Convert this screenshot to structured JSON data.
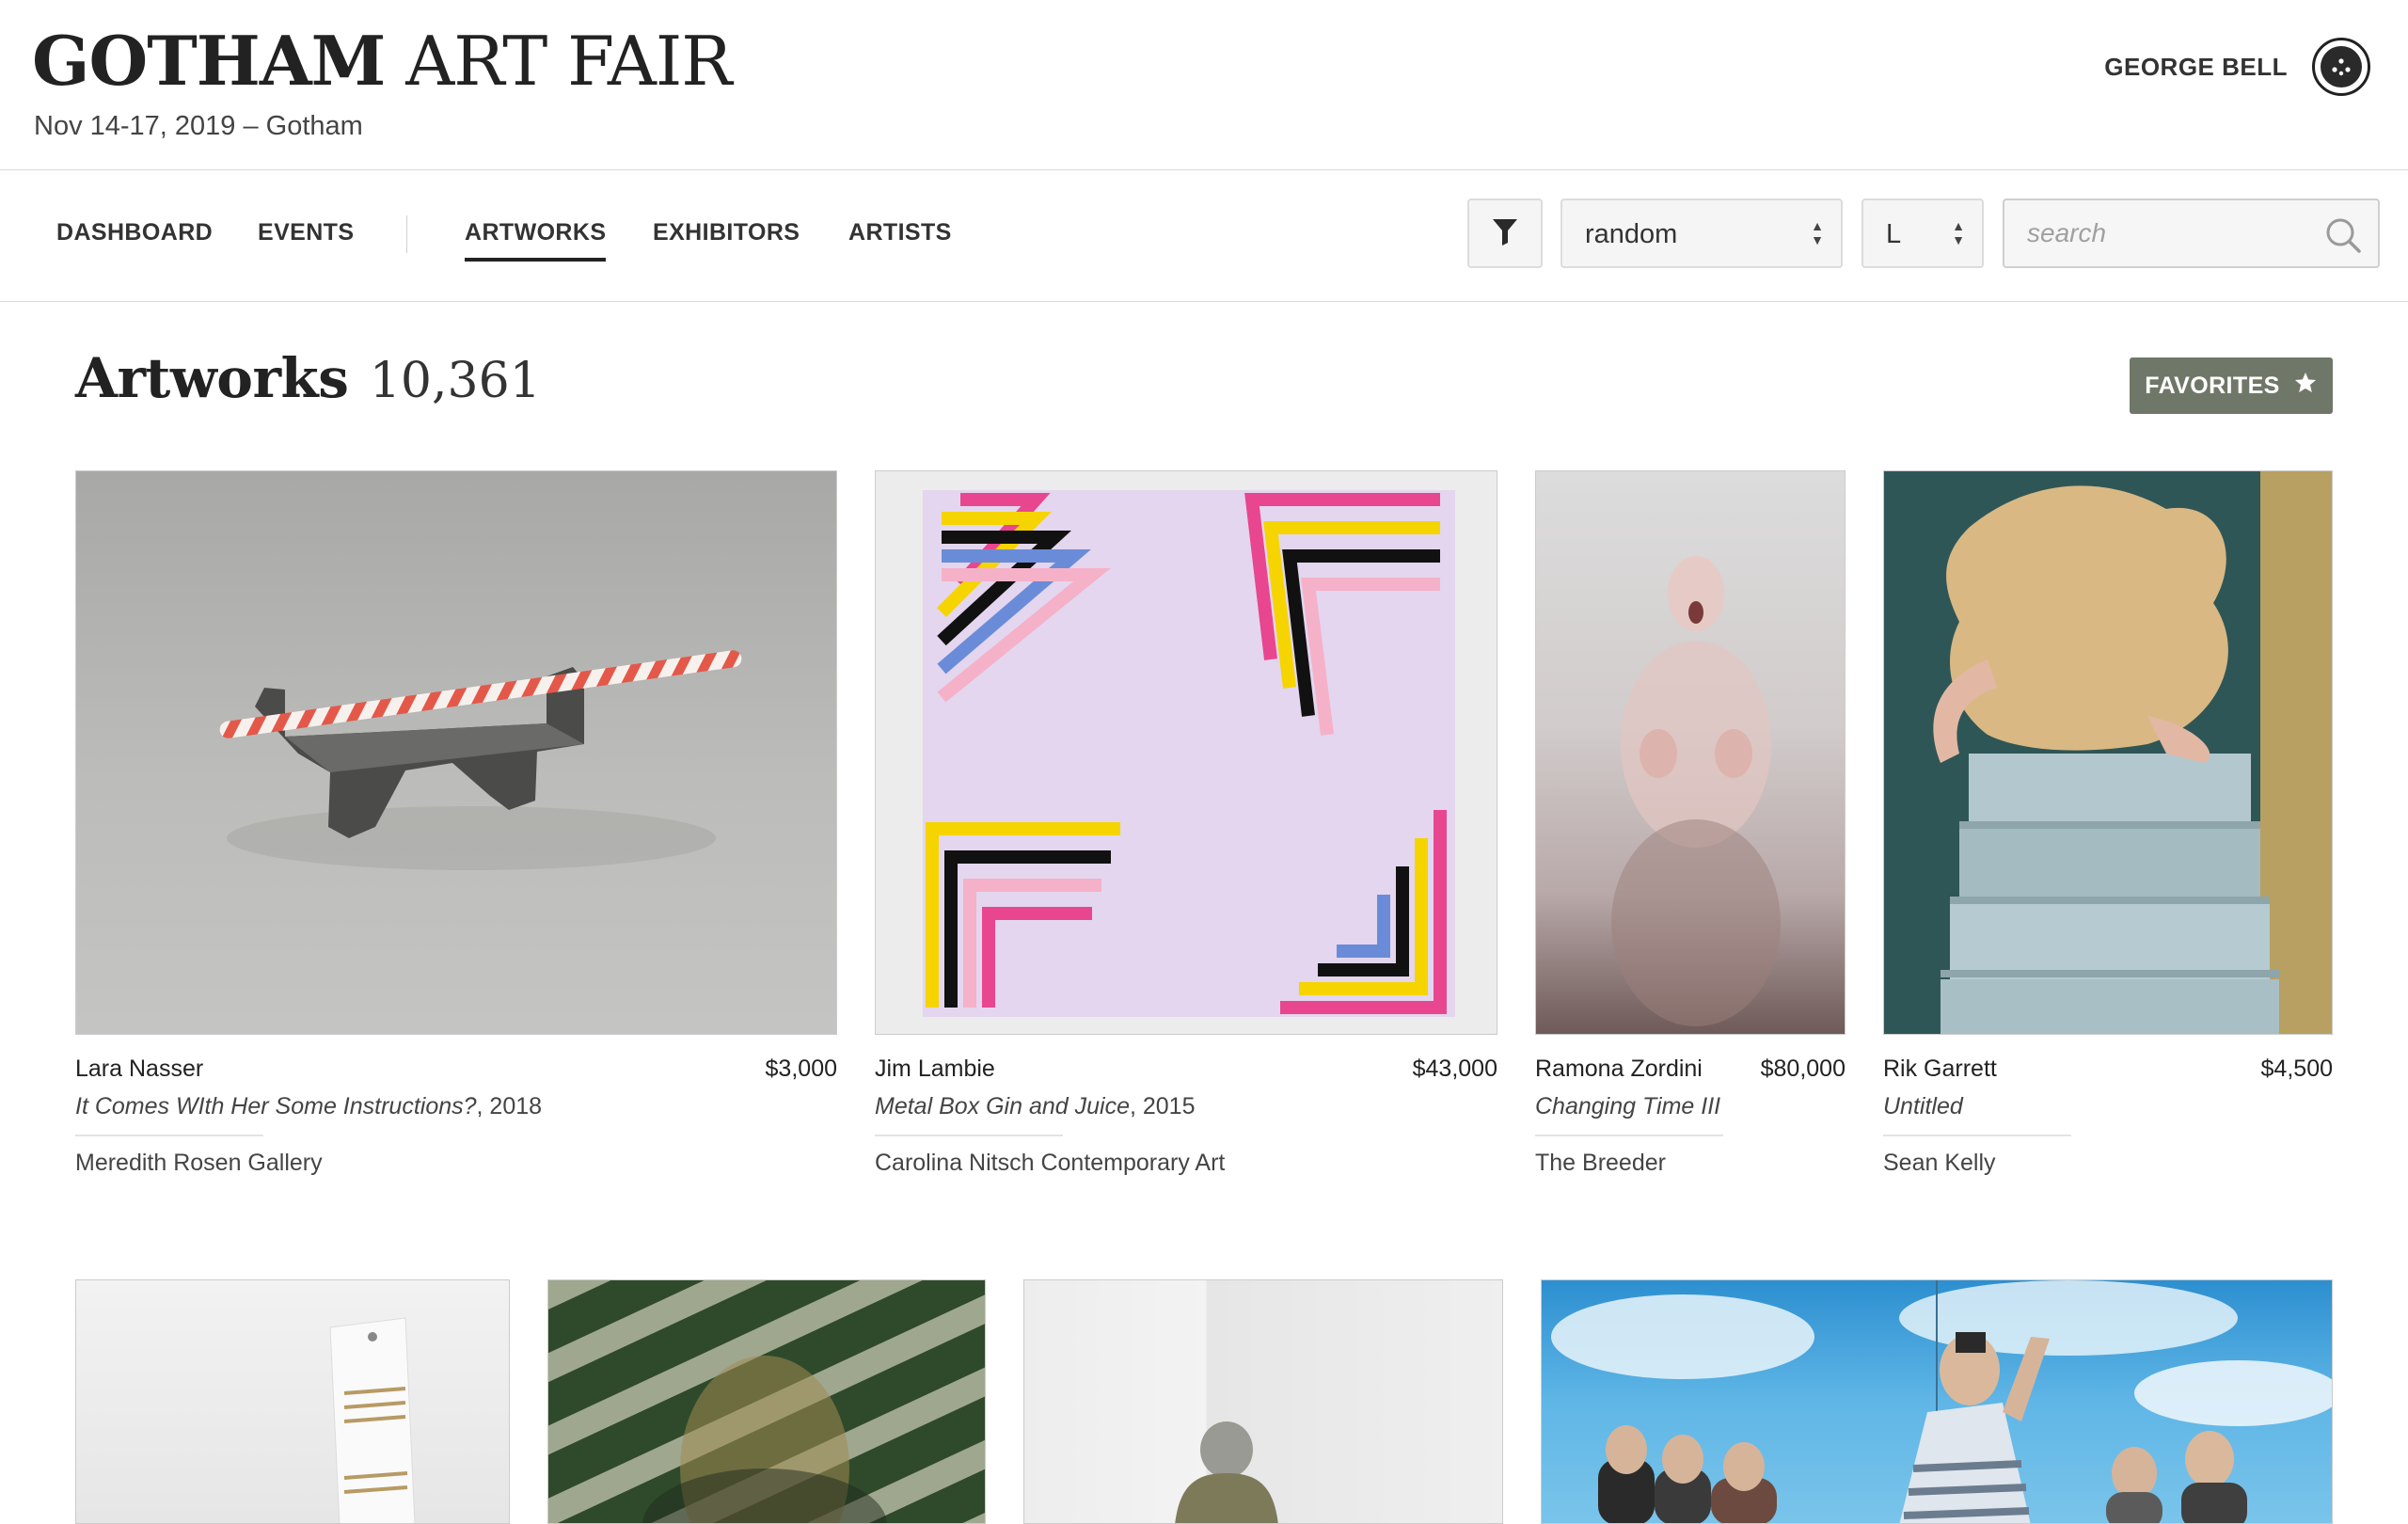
{
  "brand": {
    "strong": "GOTHAM",
    "light": "ART FAIR"
  },
  "dates": "Nov 14-17, 2019 – Gotham",
  "user": {
    "name": "GEORGE BELL"
  },
  "nav": {
    "items": [
      "DASHBOARD",
      "EVENTS",
      "ARTWORKS",
      "EXHIBITORS",
      "ARTISTS"
    ],
    "active": "ARTWORKS"
  },
  "controls": {
    "sort_value": "random",
    "size_value": "L",
    "search_placeholder": "search"
  },
  "page": {
    "title": "Artworks",
    "count": "10,361",
    "favorites_label": "FAVORITES"
  },
  "artworks": [
    {
      "artist": "Lara Nasser",
      "price": "$3,000",
      "title": "It Comes WIth Her Some Instructions?",
      "year": ", 2018",
      "gallery": "Meredith Rosen Gallery"
    },
    {
      "artist": "Jim Lambie",
      "price": "$43,000",
      "title": "Metal Box Gin and Juice",
      "year": ", 2015",
      "gallery": "Carolina Nitsch Contemporary Art"
    },
    {
      "artist": "Ramona Zordini",
      "price": "$80,000",
      "title": "Changing Time III",
      "year": "",
      "gallery": "The Breeder"
    },
    {
      "artist": "Rik Garrett",
      "price": "$4,500",
      "title": "Untitled",
      "year": "",
      "gallery": "Sean Kelly"
    }
  ],
  "colors": {
    "favorites_bg": "#6f7868",
    "text": "#222222",
    "rule": "#d9d9d9"
  }
}
